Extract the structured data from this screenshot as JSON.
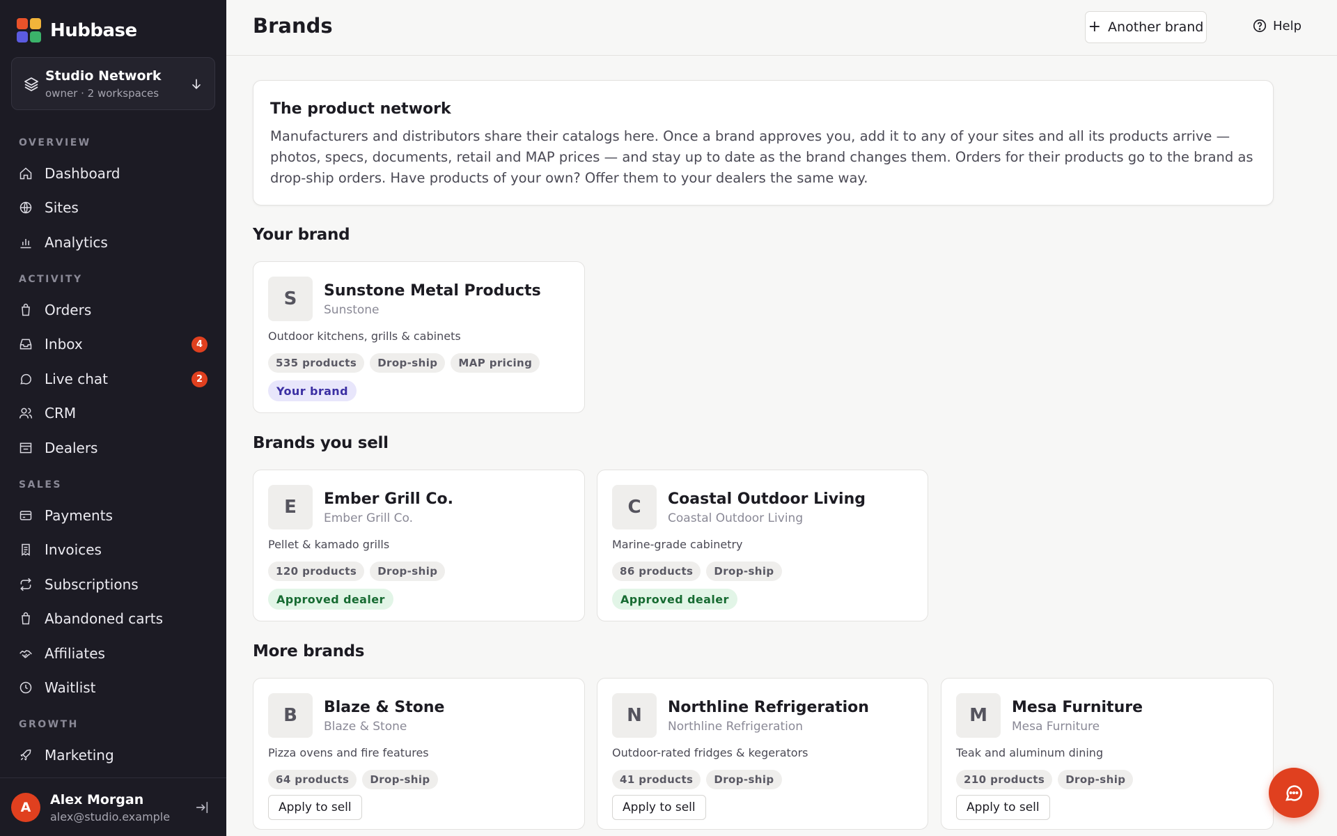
{
  "app": {
    "name": "Hubbase",
    "logo_colors": [
      "#e8522a",
      "#f1b43a",
      "#5b5be0",
      "#3bb36a"
    ]
  },
  "workspace": {
    "name": "Studio Network",
    "sub": "owner · 2 workspaces"
  },
  "sidebar": {
    "sections": [
      "OVERVIEW",
      "ACTIVITY",
      "SALES",
      "GROWTH"
    ],
    "items": [
      {
        "label": "Dashboard",
        "icon": "home-icon"
      },
      {
        "label": "Sites",
        "icon": "globe-icon"
      },
      {
        "label": "Analytics",
        "icon": "bar-chart-icon"
      },
      {
        "label": "Orders",
        "icon": "shopping-bag-icon"
      },
      {
        "label": "Inbox",
        "icon": "inbox-icon",
        "badge": "4"
      },
      {
        "label": "Live chat",
        "icon": "chat-bubble-icon",
        "badge": "2"
      },
      {
        "label": "CRM",
        "icon": "users-icon"
      },
      {
        "label": "Dealers",
        "icon": "store-icon"
      },
      {
        "label": "Payments",
        "icon": "credit-card-icon"
      },
      {
        "label": "Invoices",
        "icon": "receipt-icon"
      },
      {
        "label": "Subscriptions",
        "icon": "repeat-icon"
      },
      {
        "label": "Abandoned carts",
        "icon": "shopping-bag-icon"
      },
      {
        "label": "Affiliates",
        "icon": "handshake-icon"
      },
      {
        "label": "Waitlist",
        "icon": "clock-icon"
      },
      {
        "label": "Marketing",
        "icon": "rocket-icon"
      }
    ]
  },
  "user": {
    "initial": "A",
    "name": "Alex Morgan",
    "email": "alex@studio.example"
  },
  "header": {
    "title": "Brands",
    "add_label": "Another brand",
    "help_label": "Help"
  },
  "info": {
    "title": "The product network",
    "text": "Manufacturers and distributors share their catalogs here. Once a brand approves you, add it to any of your sites and all its products arrive — photos, specs, documents, retail and MAP prices — and stay up to date as the brand changes them. Orders for their products go to the brand as drop-ship orders. Have products of your own? Offer them to your dealers the same way."
  },
  "sections": {
    "your_brand": "Your brand",
    "brands_you_sell": "Brands you sell",
    "more_brands": "More brands"
  },
  "your_brand": {
    "initial": "S",
    "name": "Sunstone Metal Products",
    "sub": "Sunstone",
    "desc": "Outdoor kitchens, grills & cabinets",
    "tags": [
      "535 products",
      "Drop-ship",
      "MAP pricing"
    ],
    "status": "Your brand"
  },
  "selling": [
    {
      "initial": "E",
      "name": "Ember Grill Co.",
      "sub": "Ember Grill Co.",
      "desc": "Pellet & kamado grills",
      "tags": [
        "120 products",
        "Drop-ship"
      ],
      "status": "Approved dealer"
    },
    {
      "initial": "C",
      "name": "Coastal Outdoor Living",
      "sub": "Coastal Outdoor Living",
      "desc": "Marine-grade cabinetry",
      "tags": [
        "86 products",
        "Drop-ship"
      ],
      "status": "Approved dealer"
    }
  ],
  "more": [
    {
      "initial": "B",
      "name": "Blaze & Stone",
      "sub": "Blaze & Stone",
      "desc": "Pizza ovens and fire features",
      "tags": [
        "64 products",
        "Drop-ship"
      ],
      "action": "Apply to sell"
    },
    {
      "initial": "N",
      "name": "Northline Refrigeration",
      "sub": "Northline Refrigeration",
      "desc": "Outdoor-rated fridges & kegerators",
      "tags": [
        "41 products",
        "Drop-ship"
      ],
      "action": "Apply to sell"
    },
    {
      "initial": "M",
      "name": "Mesa Furniture",
      "sub": "Mesa Furniture",
      "desc": "Teak and aluminum dining",
      "tags": [
        "210 products",
        "Drop-ship"
      ],
      "action": "Apply to sell"
    }
  ]
}
